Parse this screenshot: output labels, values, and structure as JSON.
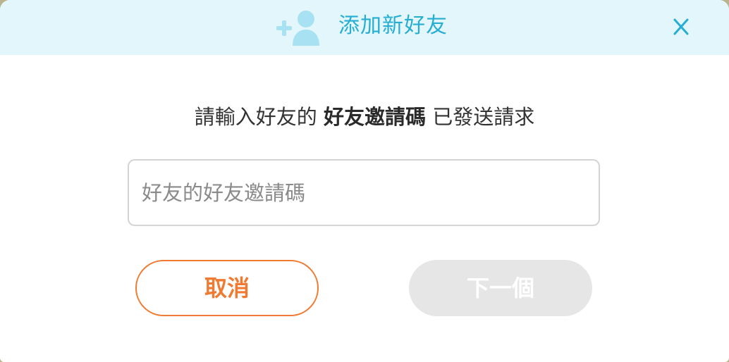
{
  "dialog": {
    "title": "添加新好友",
    "close_label": "X",
    "header_icon": "add-user-icon"
  },
  "prompt": {
    "before": "請輸入好友的 ",
    "bold": "好友邀請碼",
    "after": " 已發送請求"
  },
  "invite_code_input": {
    "value": "",
    "placeholder": "好友的好友邀請碼"
  },
  "buttons": {
    "cancel_label": "取消",
    "next_label": "下一個",
    "next_enabled": false
  },
  "colors": {
    "header_bg": "#e2f6fb",
    "accent_blue": "#26aed2",
    "icon_blue": "#a8e2f2",
    "cancel_orange": "#f07a31",
    "disabled_gray": "#e6e6e6"
  }
}
